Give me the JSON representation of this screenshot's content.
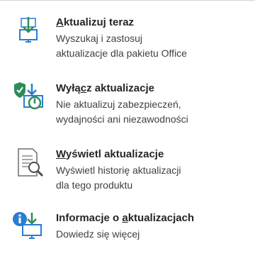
{
  "accent": "#2b7cd3",
  "green": "#2e8b57",
  "items": [
    {
      "icon": "download-update-icon",
      "title_access": "A",
      "title_rest": "ktualizuj teraz",
      "desc": [
        "Wyszukaj i zastosuj",
        "aktualizacje dla pakietu Office"
      ]
    },
    {
      "icon": "shield-disable-update-icon",
      "title_pre": "Wyłą",
      "title_access": "c",
      "title_rest": "z aktualizacje",
      "desc": [
        "Nie aktualizuj zabezpieczeń,",
        "wydajności ani niezawodności"
      ]
    },
    {
      "icon": "view-history-icon",
      "title_access": "W",
      "title_rest": "yświetl aktualizacje",
      "desc": [
        "Wyświetl historię aktualizacji",
        "dla tego produktu"
      ]
    },
    {
      "icon": "info-update-icon",
      "title_pre": "Informacje o ",
      "title_access": "a",
      "title_rest": "ktualizacjach",
      "desc": [
        "Dowiedz się więcej"
      ]
    }
  ]
}
